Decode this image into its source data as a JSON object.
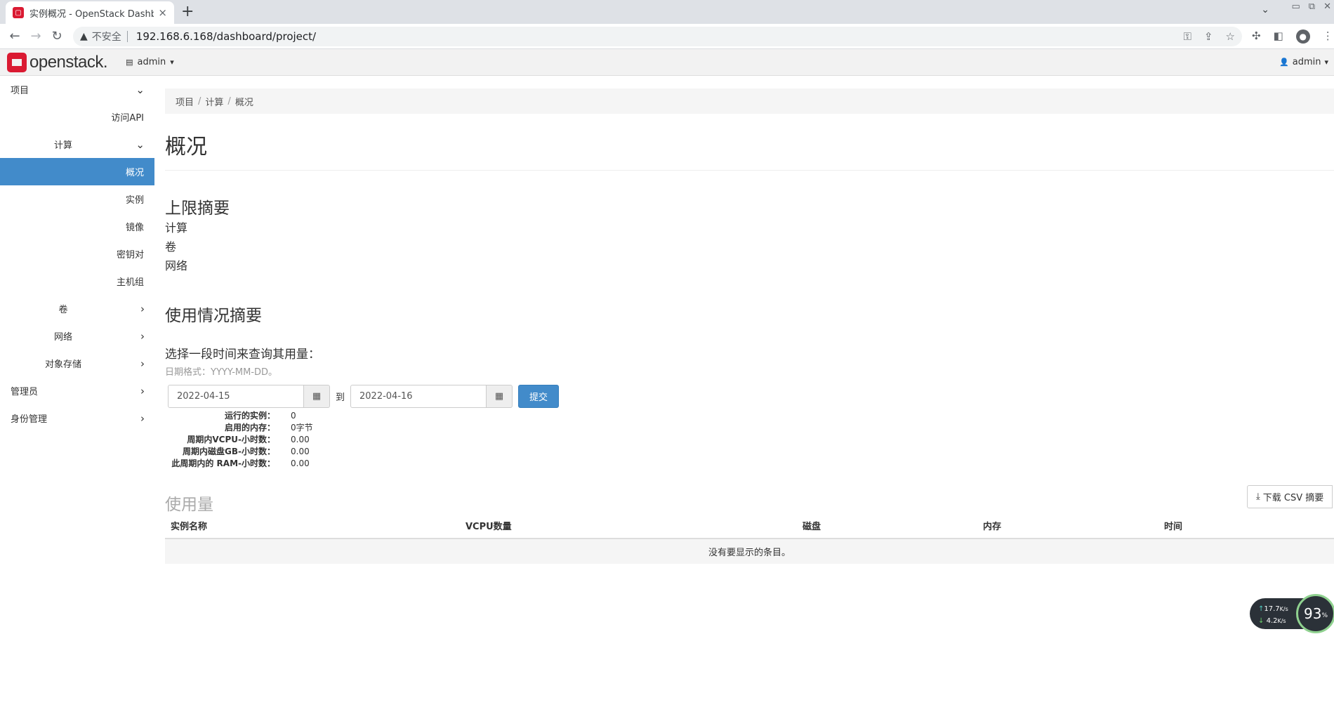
{
  "browser": {
    "tab_title": "实例概况 - OpenStack Dashboa",
    "tab_close": "×",
    "new_tab": "+",
    "insecure_label": "不安全",
    "url": "192.168.6.168/dashboard/project/",
    "window_controls": [
      "▭",
      "⧉",
      "✕"
    ]
  },
  "navbar": {
    "logo_text": "openstack.",
    "project": "admin",
    "user": "admin"
  },
  "sidebar": {
    "project": "项目",
    "api_access": "访问API",
    "compute": "计算",
    "overview": "概况",
    "instances": "实例",
    "images": "镜像",
    "keypairs": "密钥对",
    "server_groups": "主机组",
    "volumes": "卷",
    "network": "网络",
    "object_store": "对象存储",
    "admin": "管理员",
    "identity": "身份管理"
  },
  "breadcrumb": [
    "项目",
    "计算",
    "概况"
  ],
  "page_title": "概况",
  "limits": {
    "heading": "上限摘要",
    "items": [
      "计算",
      "卷",
      "网络"
    ]
  },
  "usage_summary": {
    "heading": "使用情况摘要",
    "query_label": "选择一段时间来查询其用量：",
    "date_hint": "日期格式：YYYY-MM-DD。",
    "start_date": "2022-04-15",
    "to_label": "到",
    "end_date": "2022-04-16",
    "submit": "提交",
    "stats": [
      {
        "label": "运行的实例：",
        "value": "0"
      },
      {
        "label": "启用的内存：",
        "value": "0字节"
      },
      {
        "label": "周期内VCPU-小时数：",
        "value": "0.00"
      },
      {
        "label": "周期内磁盘GB-小时数：",
        "value": "0.00"
      },
      {
        "label": "此周期内的 RAM-小时数：",
        "value": "0.00"
      }
    ]
  },
  "usage": {
    "heading": "使用量",
    "csv_button": "下载 CSV 摘要",
    "columns": [
      "实例名称",
      "VCPU数量",
      "磁盘",
      "内存",
      "时间"
    ],
    "empty_message": "没有要显示的条目。"
  },
  "net_widget": {
    "upload": "17.7",
    "download": "4.2",
    "unit": "K/s",
    "percent": "93",
    "percent_unit": "%"
  }
}
